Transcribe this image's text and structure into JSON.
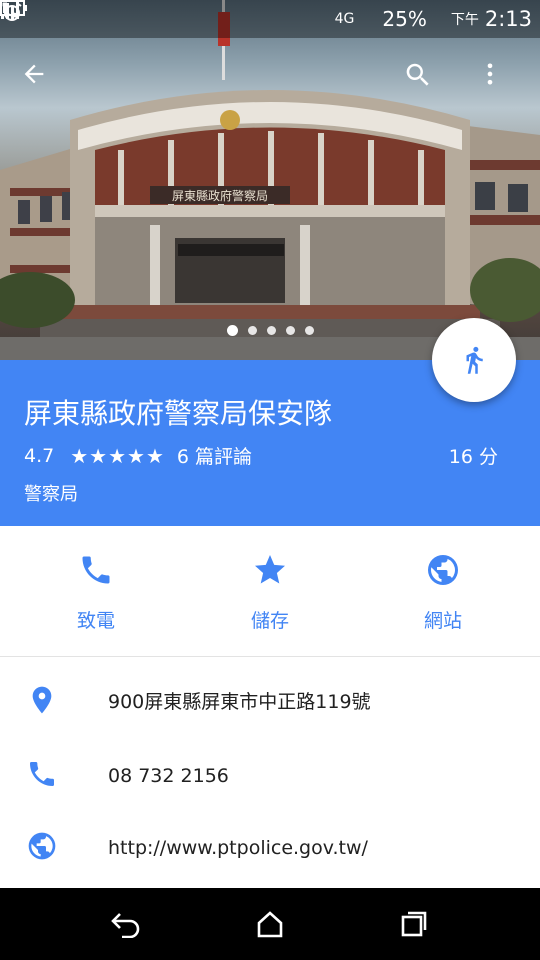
{
  "status_bar": {
    "network": "4G",
    "battery": "25%",
    "ampm": "下午",
    "time": "2:13"
  },
  "hero": {
    "photo_count": 5,
    "active_photo": 1,
    "sign_text": "屏東縣政府警察局"
  },
  "place": {
    "name": "屏東縣政府警察局保安隊",
    "rating": "4.7",
    "stars": "★★★★★",
    "reviews": "6 篇評論",
    "travel_time": "16 分",
    "category": "警察局"
  },
  "actions": [
    {
      "label": "致電",
      "icon": "phone-icon"
    },
    {
      "label": "儲存",
      "icon": "star-icon"
    },
    {
      "label": "網站",
      "icon": "globe-icon"
    }
  ],
  "details": {
    "address": "900屏東縣屏東市中正路119號",
    "phone": "08 732 2156",
    "website": "http://www.ptpolice.gov.tw/"
  },
  "colors": {
    "accent": "#4285f4",
    "text": "#212121"
  }
}
